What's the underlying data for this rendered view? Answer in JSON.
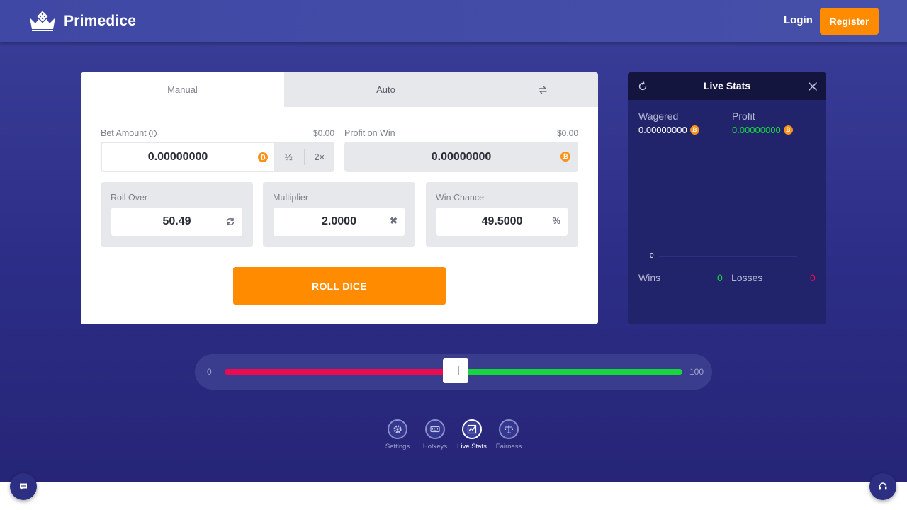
{
  "header": {
    "brand": "Primedice",
    "login_label": "Login",
    "register_label": "Register"
  },
  "game": {
    "tabs": [
      {
        "label": "Manual"
      },
      {
        "label": "Auto"
      }
    ],
    "bet_amount": {
      "label": "Bet Amount",
      "usd": "$0.00",
      "value": "0.00000000",
      "half_label": "½",
      "double_label": "2×"
    },
    "profit_on_win": {
      "label": "Profit on Win",
      "usd": "$0.00",
      "value": "0.00000000"
    },
    "roll_over": {
      "label": "Roll Over",
      "value": "50.49"
    },
    "multiplier": {
      "label": "Multiplier",
      "value": "2.0000"
    },
    "win_chance": {
      "label": "Win Chance",
      "value": "49.5000",
      "suffix": "%"
    },
    "roll_button": "ROLL DICE"
  },
  "live_stats": {
    "title": "Live Stats",
    "wagered_label": "Wagered",
    "wagered_value": "0.00000000",
    "profit_label": "Profit",
    "profit_value": "0.00000000",
    "chart_zero": "0",
    "wins_label": "Wins",
    "wins_value": "0",
    "losses_label": "Losses",
    "losses_value": "0"
  },
  "slider": {
    "min_label": "0",
    "max_label": "100",
    "value": 50.49
  },
  "bottom_nav": [
    {
      "label": "Settings",
      "icon": "gear-icon"
    },
    {
      "label": "Hotkeys",
      "icon": "keyboard-icon"
    },
    {
      "label": "Live Stats",
      "icon": "chart-icon"
    },
    {
      "label": "Fairness",
      "icon": "scales-icon"
    }
  ],
  "colors": {
    "accent": "#ff8c00",
    "win_green": "#18d640",
    "loss_red": "#ec0b51",
    "btc": "#f7931a"
  }
}
